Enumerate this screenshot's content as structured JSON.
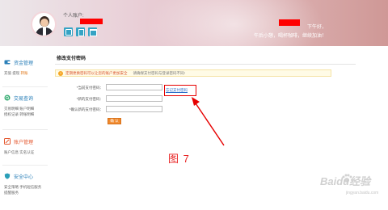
{
  "header": {
    "account_label": "个人账户:",
    "greeting_suffix": "下午好，",
    "tagline": "午后小憩，喝杯咖啡，继续加油！"
  },
  "sidebar": {
    "groups": [
      {
        "title": "资金管理",
        "links": [
          "充值",
          "提现",
          "转账"
        ],
        "icon": "wallet-icon"
      },
      {
        "title": "交易查询",
        "links": [
          "交易明细",
          "账户明细",
          "授权记录",
          "转账明细"
        ],
        "icon": "search-icon"
      },
      {
        "title": "账户管理",
        "links": [
          "账户信息",
          "实名认证"
        ],
        "icon": "edit-icon"
      },
      {
        "title": "安全中心",
        "links": [
          "安全策略",
          "手机短信服务",
          "提醒服务"
        ],
        "icon": "shield-icon"
      }
    ]
  },
  "main": {
    "page_title": "修改支付密码",
    "notice_strong": "定期更换密码可以让您的账户更加安全",
    "notice_normal": "请确保支付密码与登录密码不同!",
    "fields": [
      {
        "label": "*当前支付密码：",
        "value": ""
      },
      {
        "label": "*新的支付密码：",
        "value": ""
      },
      {
        "label": "*确认新的支付密码：",
        "value": ""
      }
    ],
    "forgot_link": "忘记支付密码",
    "confirm_button": "确 认"
  },
  "annotation": {
    "figure_label": "图 7"
  },
  "watermark": {
    "brand": "Baidu经验",
    "url": "jingyan.baidu.com"
  },
  "colors": {
    "highlight_red": "#e60000",
    "accent_orange": "#f0892c",
    "link_blue": "#2a6cc7",
    "sidebar_blue": "#2a7fb8"
  }
}
